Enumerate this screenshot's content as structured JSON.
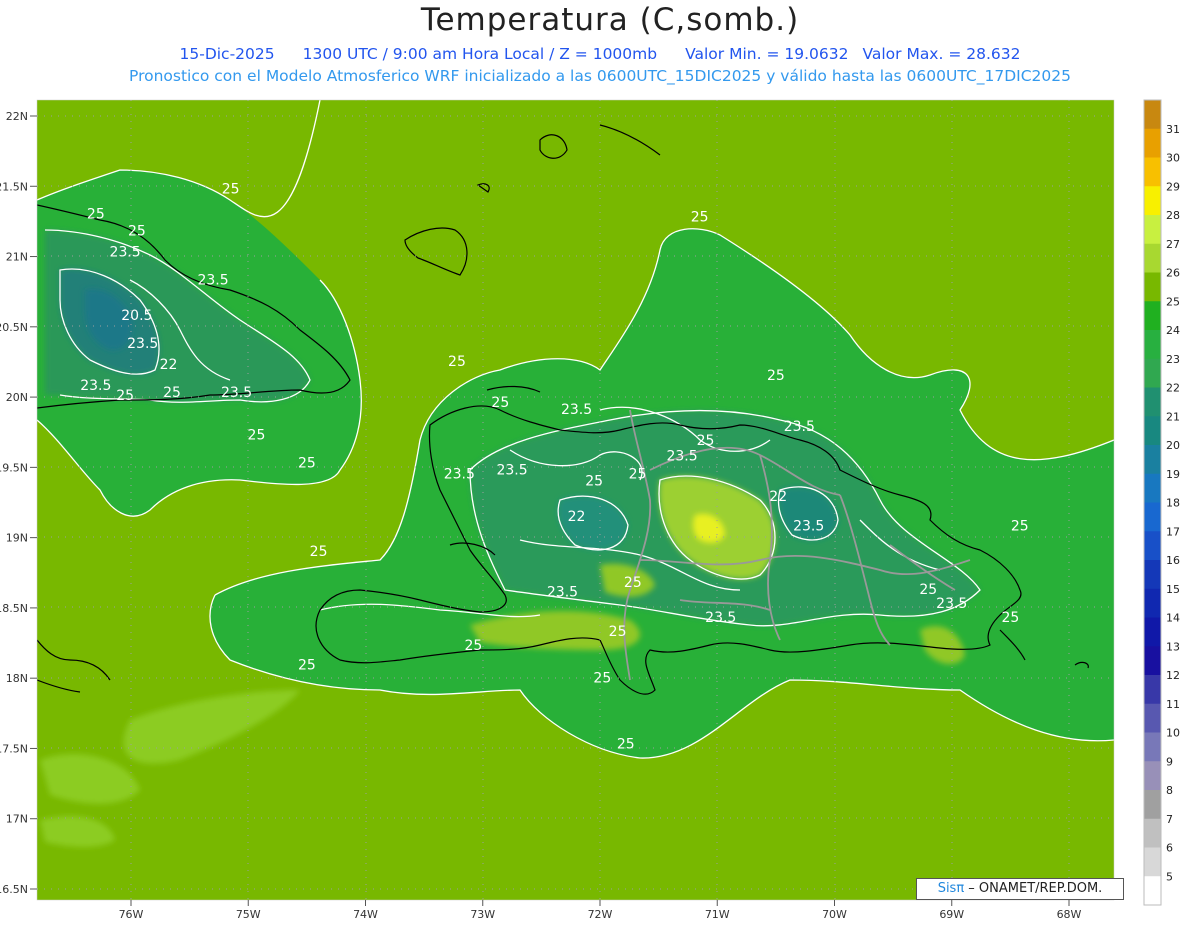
{
  "header": {
    "title": "Temperatura (C,somb.)",
    "date": "15-Dic-2025",
    "time_utc": "1300 UTC / 9:00 am Hora Local / Z = 1000mb",
    "min_text": "Valor Min. = 19.0632",
    "max_text": "Valor Max. = 28.632",
    "model_line": "Pronostico con el Modelo Atmosferico WRF inicializado a las 0600UTC_15DIC2025 y válido hasta las  0600UTC_17DIC2025"
  },
  "credit": {
    "brand": "Sisπ",
    "text": " – ONAMET/REP.DOM."
  },
  "axes": {
    "lat_labels": [
      "22N",
      "21.5N",
      "21N",
      "20.5N",
      "20N",
      "19.5N",
      "19N",
      "18.5N",
      "18N",
      "17.5N",
      "17N",
      "16.5N"
    ],
    "lat_values": [
      22,
      21.5,
      21,
      20.5,
      20,
      19.5,
      19,
      18.5,
      18,
      17.5,
      17,
      16.5
    ],
    "lon_labels": [
      "76W",
      "75W",
      "74W",
      "73W",
      "72W",
      "71W",
      "70W",
      "69W",
      "68W"
    ],
    "lon_values": [
      -76,
      -75,
      -74,
      -73,
      -72,
      -71,
      -70,
      -69,
      -68
    ],
    "lat_range": [
      16.4,
      22.1
    ],
    "lon_range": [
      -76.7,
      -67.6
    ]
  },
  "colorbar": {
    "labels": [
      "31",
      "30",
      "29",
      "28",
      "27",
      "26",
      "25",
      "24",
      "23",
      "22",
      "21",
      "20",
      "19",
      "18",
      "17",
      "16",
      "15",
      "14",
      "13",
      "12",
      "11",
      "10",
      "9",
      "8",
      "7",
      "6",
      "5"
    ],
    "colors": [
      "#c88810",
      "#e8a000",
      "#f8c000",
      "#f8f000",
      "#c8f040",
      "#a8d830",
      "#78b800",
      "#20b020",
      "#28b040",
      "#30a850",
      "#209070",
      "#188880",
      "#1a80a0",
      "#1878c0",
      "#1868d0",
      "#1850c8",
      "#1438b8",
      "#1028b0",
      "#1018a8",
      "#1810a0",
      "#3838a8",
      "#5858b0",
      "#7878b8",
      "#9890b8",
      "#a0a0a0",
      "#c0c0c0",
      "#d8d8d8",
      "#ffffff"
    ]
  },
  "contour_labels": [
    {
      "text": "25",
      "lat": 21.45,
      "lon": -75.15
    },
    {
      "text": "25",
      "lat": 21.27,
      "lon": -76.3
    },
    {
      "text": "25",
      "lat": 21.15,
      "lon": -75.95
    },
    {
      "text": "23.5",
      "lat": 21.0,
      "lon": -76.05
    },
    {
      "text": "23.5",
      "lat": 20.8,
      "lon": -75.3
    },
    {
      "text": "20.5",
      "lat": 20.55,
      "lon": -75.95
    },
    {
      "text": "23.5",
      "lat": 20.35,
      "lon": -75.9
    },
    {
      "text": "22",
      "lat": 20.2,
      "lon": -75.68
    },
    {
      "text": "23.5",
      "lat": 20.05,
      "lon": -76.3
    },
    {
      "text": "25",
      "lat": 19.98,
      "lon": -76.05
    },
    {
      "text": "25",
      "lat": 20.0,
      "lon": -75.65
    },
    {
      "text": "23.5",
      "lat": 20.0,
      "lon": -75.1
    },
    {
      "text": "25",
      "lat": 19.7,
      "lon": -74.93
    },
    {
      "text": "25",
      "lat": 19.5,
      "lon": -74.5
    },
    {
      "text": "25",
      "lat": 21.25,
      "lon": -71.15
    },
    {
      "text": "25",
      "lat": 20.22,
      "lon": -73.22
    },
    {
      "text": "25",
      "lat": 20.12,
      "lon": -70.5
    },
    {
      "text": "25",
      "lat": 19.93,
      "lon": -72.85
    },
    {
      "text": "23.5",
      "lat": 19.88,
      "lon": -72.2
    },
    {
      "text": "25",
      "lat": 19.66,
      "lon": -71.1
    },
    {
      "text": "23.5",
      "lat": 19.55,
      "lon": -71.3
    },
    {
      "text": "23.5",
      "lat": 19.76,
      "lon": -70.3
    },
    {
      "text": "23.5",
      "lat": 19.42,
      "lon": -73.2
    },
    {
      "text": "23.5",
      "lat": 19.45,
      "lon": -72.75
    },
    {
      "text": "25",
      "lat": 19.37,
      "lon": -72.05
    },
    {
      "text": "25",
      "lat": 19.42,
      "lon": -71.68
    },
    {
      "text": "22",
      "lat": 19.26,
      "lon": -70.48
    },
    {
      "text": "22",
      "lat": 19.12,
      "lon": -72.2
    },
    {
      "text": "23.5",
      "lat": 19.05,
      "lon": -70.22
    },
    {
      "text": "25",
      "lat": 19.05,
      "lon": -68.42
    },
    {
      "text": "25",
      "lat": 18.87,
      "lon": -74.4
    },
    {
      "text": "25",
      "lat": 18.65,
      "lon": -71.72
    },
    {
      "text": "23.5",
      "lat": 18.58,
      "lon": -72.32
    },
    {
      "text": "25",
      "lat": 18.6,
      "lon": -69.2
    },
    {
      "text": "23.5",
      "lat": 18.5,
      "lon": -69.0
    },
    {
      "text": "23.5",
      "lat": 18.4,
      "lon": -70.97
    },
    {
      "text": "25",
      "lat": 18.4,
      "lon": -68.5
    },
    {
      "text": "25",
      "lat": 18.3,
      "lon": -71.85
    },
    {
      "text": "25",
      "lat": 18.2,
      "lon": -73.08
    },
    {
      "text": "25",
      "lat": 18.06,
      "lon": -74.5
    },
    {
      "text": "25",
      "lat": 17.97,
      "lon": -71.98
    },
    {
      "text": "25",
      "lat": 17.5,
      "lon": -71.78
    }
  ],
  "colors": {
    "subtitle1": "#2255ee",
    "subtitle2": "#3399ee",
    "contour": "#ffffff",
    "coast": "#000000",
    "border": "#999999",
    "grid": "#9aa0a0"
  }
}
